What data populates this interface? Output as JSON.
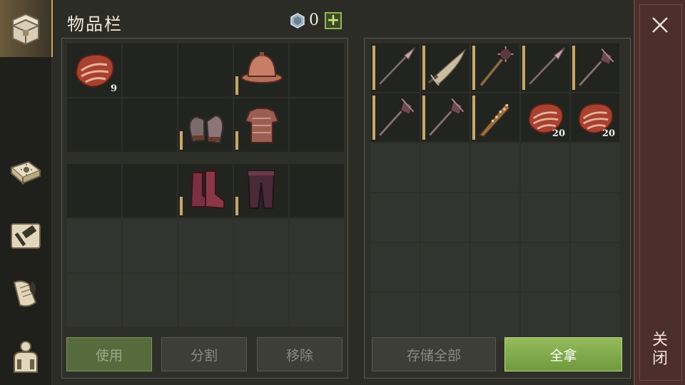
{
  "header": {
    "title": "物品栏",
    "gem_count": "0",
    "plus_label": "+"
  },
  "sidebar": {
    "items": [
      {
        "name": "inventory",
        "icon": "chest-icon",
        "active": true
      },
      {
        "name": "skills",
        "icon": "sun-book-icon",
        "active": false
      },
      {
        "name": "crafting",
        "icon": "hammer-icon",
        "active": false
      },
      {
        "name": "quests",
        "icon": "scroll-quill-icon",
        "active": false
      },
      {
        "name": "character",
        "icon": "character-icon",
        "active": false
      }
    ]
  },
  "equipment": {
    "row1": [
      {
        "item": "meat-icon",
        "qty": "9",
        "bar": false
      },
      {
        "item": "",
        "qty": "",
        "bar": false
      },
      {
        "item": "",
        "qty": "",
        "bar": false
      },
      {
        "item": "helmet-icon",
        "qty": "",
        "bar": true
      },
      {
        "item": "",
        "qty": "",
        "bar": false
      }
    ],
    "row2": [
      {
        "item": "",
        "qty": "",
        "bar": false
      },
      {
        "item": "",
        "qty": "",
        "bar": false
      },
      {
        "item": "gloves-icon",
        "qty": "",
        "bar": true
      },
      {
        "item": "chainmail-icon",
        "qty": "",
        "bar": true
      },
      {
        "item": "",
        "qty": "",
        "bar": false
      }
    ]
  },
  "backpack": {
    "row1": [
      {
        "item": "",
        "qty": "",
        "bar": false
      },
      {
        "item": "",
        "qty": "",
        "bar": false
      },
      {
        "item": "boots-icon",
        "qty": "",
        "bar": true
      },
      {
        "item": "pants-icon",
        "qty": "",
        "bar": true
      },
      {
        "item": "",
        "qty": "",
        "bar": false
      }
    ]
  },
  "container": {
    "row1": [
      {
        "item": "spear-icon",
        "qty": "",
        "bar": true
      },
      {
        "item": "sword-icon",
        "qty": "",
        "bar": true
      },
      {
        "item": "mace-icon",
        "qty": "",
        "bar": true
      },
      {
        "item": "spear-icon",
        "qty": "",
        "bar": true
      },
      {
        "item": "flanged-mace-icon",
        "qty": "",
        "bar": true
      }
    ],
    "row2": [
      {
        "item": "flanged-mace-icon",
        "qty": "",
        "bar": true
      },
      {
        "item": "flanged-mace-icon",
        "qty": "",
        "bar": true
      },
      {
        "item": "spiked-club-icon",
        "qty": "",
        "bar": true
      },
      {
        "item": "meat-icon",
        "qty": "20",
        "bar": false
      },
      {
        "item": "meat-icon",
        "qty": "20",
        "bar": false
      }
    ]
  },
  "buttons": {
    "use": "使用",
    "split": "分割",
    "remove": "移除",
    "store_all": "存储全部",
    "take_all": "全拿"
  },
  "close": {
    "label": "关闭"
  },
  "colors": {
    "accent_gold": "#c9a767",
    "take_all_green": "#7fa84a",
    "close_panel": "#4c2e2a"
  }
}
